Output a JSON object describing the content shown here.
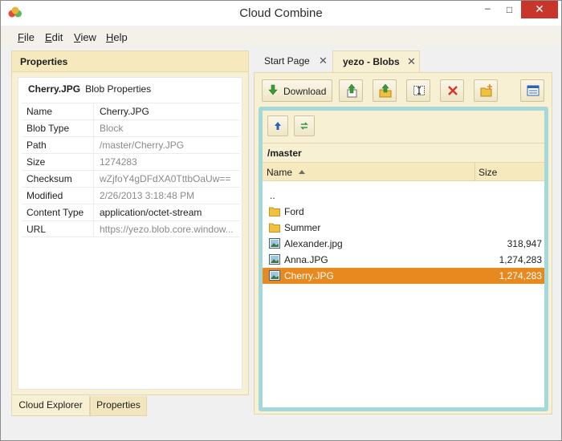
{
  "window": {
    "title": "Cloud Combine",
    "minimize": "–",
    "maximize": "□",
    "close": "✕"
  },
  "menu": [
    "File",
    "Edit",
    "View",
    "Help"
  ],
  "left_panel": {
    "header": "Properties",
    "file_name": "Cherry.JPG",
    "subtitle": "Blob Properties",
    "properties": [
      {
        "name": "Name",
        "value": "Cherry.JPG",
        "muted": false
      },
      {
        "name": "Blob Type",
        "value": "Block",
        "muted": true
      },
      {
        "name": "Path",
        "value": "/master/Cherry.JPG",
        "muted": true
      },
      {
        "name": "Size",
        "value": "1274283",
        "muted": true
      },
      {
        "name": "Checksum",
        "value": "wZjfoY4gDFdXA0TttbOaUw==",
        "muted": true
      },
      {
        "name": "Modified",
        "value": "2/26/2013 3:18:48 PM",
        "muted": true
      },
      {
        "name": "Content Type",
        "value": "application/octet-stream",
        "muted": false
      },
      {
        "name": "URL",
        "value": "https://yezo.blob.core.window...",
        "muted": true
      }
    ],
    "bottom_tabs": [
      "Cloud Explorer",
      "Properties"
    ]
  },
  "right_panel": {
    "tabs": [
      {
        "label": "Start Page",
        "active": false
      },
      {
        "label": "yezo - Blobs",
        "active": true
      }
    ],
    "tab_close": "✕",
    "toolbar": {
      "download_label": "Download",
      "buttons": [
        "upload-icon",
        "upload-folder-icon",
        "rename-icon",
        "delete-icon",
        "new-folder-icon"
      ],
      "view_button": "view-icon"
    },
    "nav": {
      "up": "up-icon",
      "refresh": "refresh-icon"
    },
    "path": "/master",
    "columns": {
      "name": "Name",
      "size": "Size"
    },
    "files": [
      {
        "name": "..",
        "size": "",
        "type": "parent"
      },
      {
        "name": "Ford",
        "size": "",
        "type": "folder"
      },
      {
        "name": "Summer",
        "size": "",
        "type": "folder"
      },
      {
        "name": "Alexander.jpg",
        "size": "318,947",
        "type": "image"
      },
      {
        "name": "Anna.JPG",
        "size": "1,274,283",
        "type": "image"
      },
      {
        "name": "Cherry.JPG",
        "size": "1,274,283",
        "type": "image",
        "selected": true
      }
    ]
  },
  "colors": {
    "accent": "#e7891e",
    "panel_bg": "#f8f0d3",
    "browser_border": "#a4d9dc",
    "close_button": "#c7352b"
  }
}
